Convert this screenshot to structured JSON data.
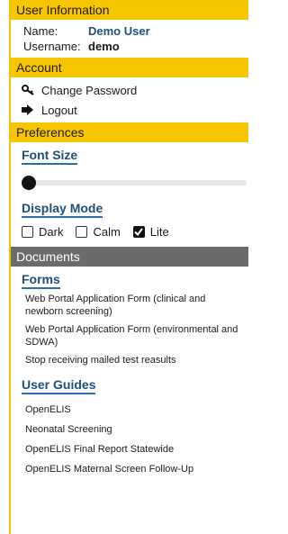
{
  "user_info": {
    "heading": "User Information",
    "name_label": "Name:",
    "name_value": "Demo User",
    "username_label": "Username:",
    "username_value": "demo"
  },
  "account": {
    "heading": "Account",
    "change_password": "Change Password",
    "logout": "Logout"
  },
  "preferences": {
    "heading": "Preferences",
    "font_size_label": "Font Size",
    "font_size_level": 0,
    "display_mode_label": "Display Mode",
    "modes": [
      {
        "label": "Dark",
        "checked": false
      },
      {
        "label": "Calm",
        "checked": false
      },
      {
        "label": "Lite",
        "checked": true
      }
    ]
  },
  "documents": {
    "heading": "Documents",
    "forms_label": "Forms",
    "forms": [
      "Web Portal Application Form (clinical and newborn screening)",
      "Web Portal Application Form (environmental and SDWA)",
      "Stop receiving mailed test reasults"
    ],
    "guides_label": "User Guides",
    "guides": [
      "OpenELIS",
      "Neonatal Screening",
      "OpenELIS Final Report Statewide",
      "OpenELIS Maternal Screen Follow-Up"
    ]
  },
  "colors": {
    "section_header": "#f7c600",
    "documents_header": "#6b6b6b",
    "link_blue": "#1f4e79"
  }
}
